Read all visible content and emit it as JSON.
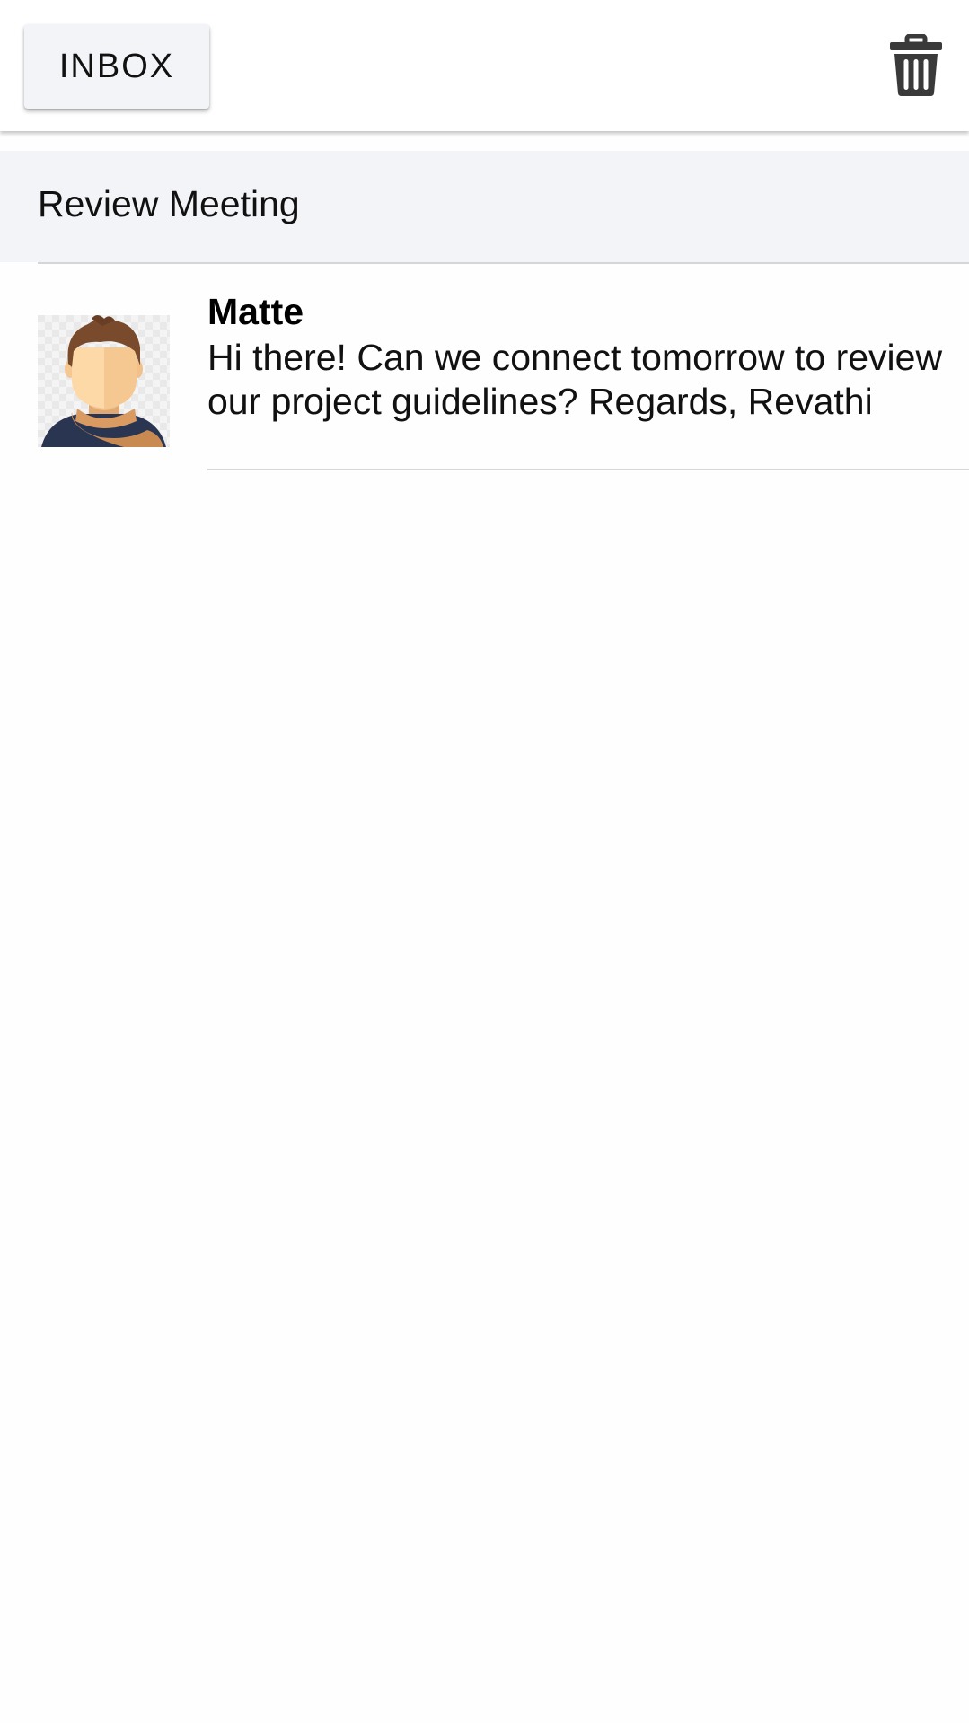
{
  "toolbar": {
    "inbox_label": "INBOX",
    "delete_icon": "trash-icon"
  },
  "thread": {
    "subject": "Review Meeting",
    "messages": [
      {
        "sender": "Matte",
        "body": "Hi there! Can we connect tomorrow to review our project guidelines? Regards, Revathi",
        "avatar_icon": "person-avatar"
      }
    ]
  },
  "colors": {
    "band_background": "#f3f4f7",
    "divider": "#d6d6d6",
    "icon": "#3a3a3a"
  }
}
